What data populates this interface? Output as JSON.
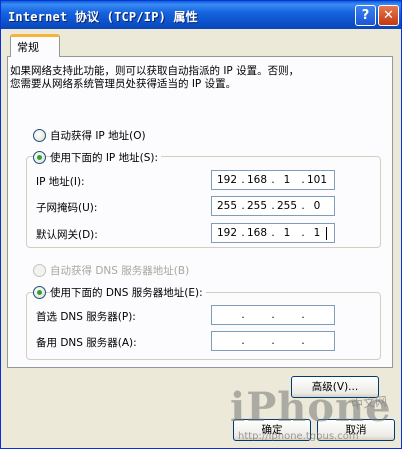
{
  "window": {
    "title": "Internet 协议 (TCP/IP) 属性",
    "help_symbol": "?",
    "close_symbol": "✕"
  },
  "tabs": [
    {
      "label": "常规",
      "selected": true
    }
  ],
  "intro": {
    "line1": "如果网络支持此功能，则可以获取自动指派的 IP 设置。否则，",
    "line2": "您需要从网络系统管理员处获得适当的 IP 设置。"
  },
  "ip_section": {
    "auto_option": {
      "label": "自动获得 IP 地址(O)",
      "checked": false
    },
    "manual_option": {
      "label": "使用下面的 IP 地址(S):",
      "checked": true
    },
    "fields": [
      {
        "label": "IP 地址(I):",
        "octets": [
          "192",
          "168",
          "1",
          "101"
        ]
      },
      {
        "label": "子网掩码(U):",
        "octets": [
          "255",
          "255",
          "255",
          "0"
        ]
      },
      {
        "label": "默认网关(D):",
        "octets": [
          "192",
          "168",
          "1",
          "1"
        ]
      }
    ]
  },
  "dns_section": {
    "auto_option": {
      "label": "自动获得 DNS 服务器地址(B)",
      "checked": false,
      "disabled": true
    },
    "manual_option": {
      "label": "使用下面的 DNS 服务器地址(E):",
      "checked": true
    },
    "fields": [
      {
        "label": "首选 DNS 服务器(P):",
        "octets": [
          "",
          "",
          "",
          ""
        ]
      },
      {
        "label": "备用 DNS 服务器(A):",
        "octets": [
          "",
          "",
          "",
          ""
        ]
      }
    ]
  },
  "buttons": {
    "advanced": "高级(V)...",
    "ok": "确定",
    "cancel": "取消"
  },
  "watermark": {
    "brand": "iPhone",
    "cn": "中文网",
    "url": "http://iphone.tgbus.com"
  },
  "colors": {
    "titlebar": "#0a4fc8",
    "tab_highlight": "#f7b43a",
    "radio_dot": "#2fa32f"
  }
}
